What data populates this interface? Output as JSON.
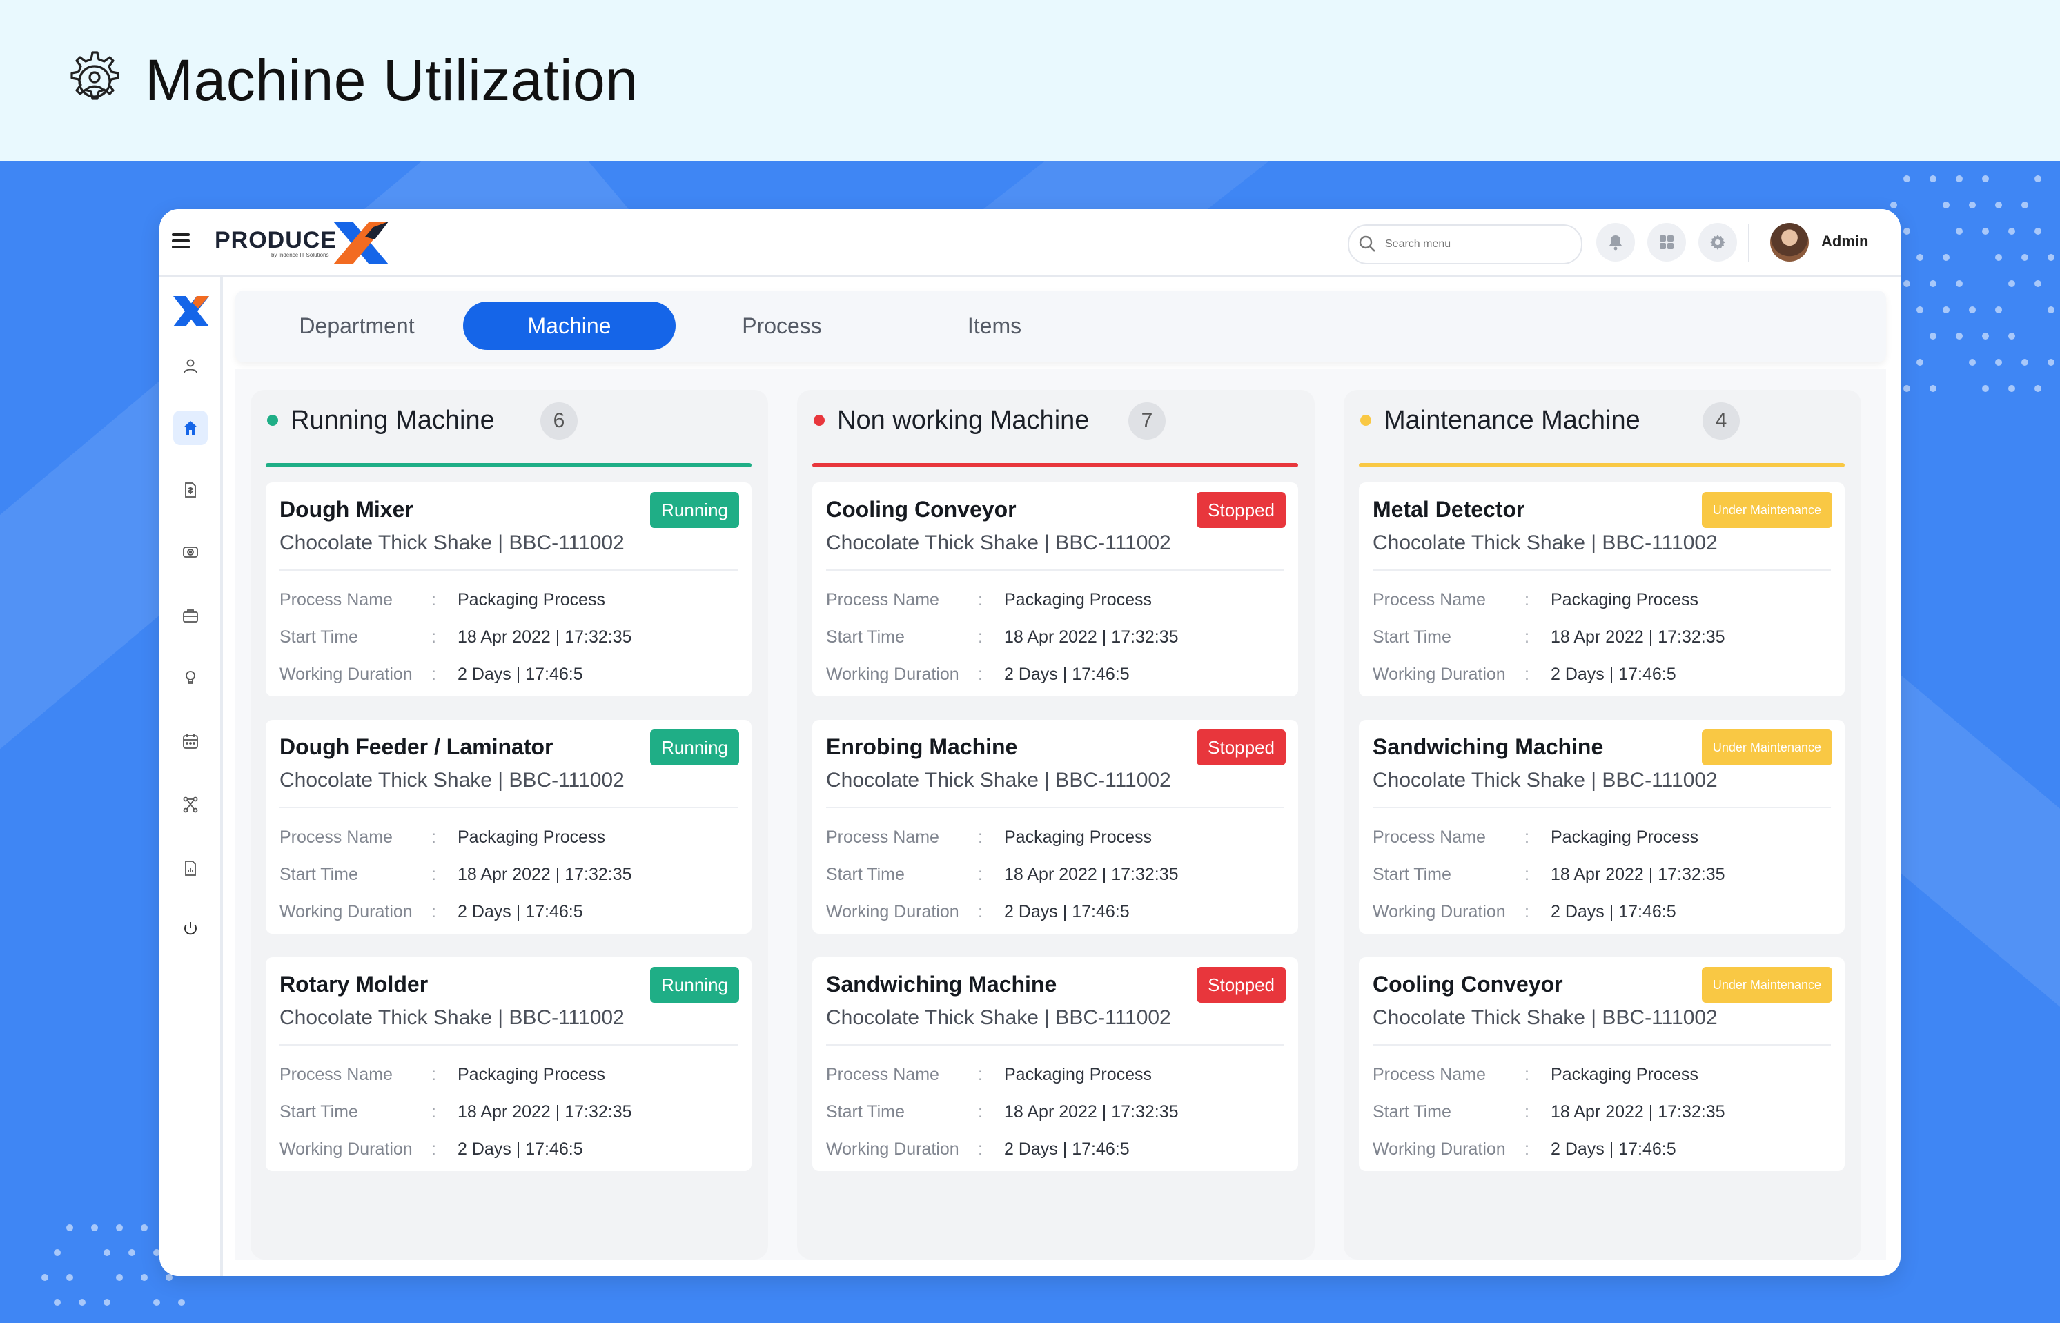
{
  "header": {
    "title": "Machine Utilization",
    "icon": "gear-person-icon"
  },
  "topbar": {
    "logo_text": "PRODUCE",
    "logo_sub": "by Indence IT Solutions",
    "search_placeholder": "Search menu",
    "user_name": "Admin"
  },
  "tabs": [
    "Department",
    "Machine",
    "Process",
    "Items"
  ],
  "active_tab": "Machine",
  "sidebar_icons": [
    "user-icon",
    "home-icon",
    "finance-icon",
    "camera-icon",
    "briefcase-icon",
    "bulb-icon",
    "calendar-icon",
    "workflow-icon",
    "report-icon",
    "power-icon"
  ],
  "field_labels": {
    "process": "Process Name",
    "start": "Start Time",
    "duration": "Working Duration"
  },
  "columns": [
    {
      "title": "Running Machine",
      "count": "6",
      "color": "#1fae86",
      "cards": [
        {
          "name": "Dough Mixer",
          "product": "Chocolate Thick Shake | BBC-111002",
          "status": "Running",
          "process": "Packaging Process",
          "start": "18 Apr 2022 | 17:32:35",
          "duration": "2 Days | 17:46:5"
        },
        {
          "name": "Dough Feeder / Laminator",
          "product": "Chocolate Thick Shake | BBC-111002",
          "status": "Running",
          "process": "Packaging Process",
          "start": "18 Apr 2022 | 17:32:35",
          "duration": "2 Days | 17:46:5"
        },
        {
          "name": "Rotary Molder",
          "product": "Chocolate Thick Shake | BBC-111002",
          "status": "Running",
          "process": "Packaging Process",
          "start": "18 Apr 2022 | 17:32:35",
          "duration": "2 Days | 17:46:5"
        }
      ]
    },
    {
      "title": "Non working Machine",
      "count": "7",
      "color": "#e8363c",
      "cards": [
        {
          "name": "Cooling Conveyor",
          "product": "Chocolate Thick Shake | BBC-111002",
          "status": "Stopped",
          "process": "Packaging Process",
          "start": "18 Apr 2022 | 17:32:35",
          "duration": "2 Days | 17:46:5"
        },
        {
          "name": "Enrobing Machine",
          "product": "Chocolate Thick Shake | BBC-111002",
          "status": "Stopped",
          "process": "Packaging Process",
          "start": "18 Apr 2022 | 17:32:35",
          "duration": "2 Days | 17:46:5"
        },
        {
          "name": "Sandwiching Machine",
          "product": "Chocolate Thick Shake | BBC-111002",
          "status": "Stopped",
          "process": "Packaging Process",
          "start": "18 Apr 2022 | 17:32:35",
          "duration": "2 Days | 17:46:5"
        }
      ]
    },
    {
      "title": "Maintenance Machine",
      "count": "4",
      "color": "#f9c844",
      "cards": [
        {
          "name": "Metal Detector",
          "product": "Chocolate Thick Shake | BBC-111002",
          "status": "Under Maintenance",
          "process": "Packaging Process",
          "start": "18 Apr 2022 | 17:32:35",
          "duration": "2 Days | 17:46:5"
        },
        {
          "name": "Sandwiching Machine",
          "product": "Chocolate Thick Shake | BBC-111002",
          "status": "Under Maintenance",
          "process": "Packaging Process",
          "start": "18 Apr 2022 | 17:32:35",
          "duration": "2 Days | 17:46:5"
        },
        {
          "name": "Cooling Conveyor",
          "product": "Chocolate Thick Shake | BBC-111002",
          "status": "Under Maintenance",
          "process": "Packaging Process",
          "start": "18 Apr 2022 | 17:32:35",
          "duration": "2 Days | 17:46:5"
        }
      ]
    }
  ],
  "colors": {
    "primary": "#1565e8",
    "backdrop": "#3f86f4",
    "header_bg": "#e9f9fe"
  }
}
